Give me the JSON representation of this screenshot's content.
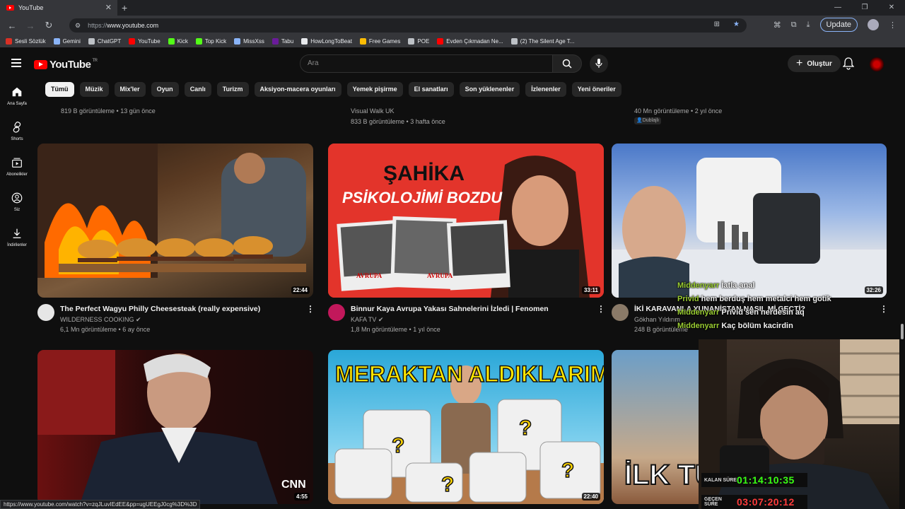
{
  "browser": {
    "tab_title": "YouTube",
    "url_scheme": "https://",
    "url_host": "www.youtube.com",
    "update_label": "Update"
  },
  "bookmarks": [
    {
      "label": "Sesli Sözlük",
      "color": "#d93025"
    },
    {
      "label": "Gemini",
      "color": "#8ab4f8"
    },
    {
      "label": "ChatGPT",
      "color": "#bdc1c6"
    },
    {
      "label": "YouTube",
      "color": "#ff0000"
    },
    {
      "label": "Kick",
      "color": "#53fc18"
    },
    {
      "label": "Top Kick",
      "color": "#53fc18"
    },
    {
      "label": "MissXss",
      "color": "#8ab4f8"
    },
    {
      "label": "Tabu",
      "color": "#6a1b9a"
    },
    {
      "label": "HowLongToBeat",
      "color": "#e8eaed"
    },
    {
      "label": "Free Games",
      "color": "#fbbc04"
    },
    {
      "label": "POE",
      "color": "#bdc1c6"
    },
    {
      "label": "Evden Çıkmadan Ne...",
      "color": "#ff0000"
    },
    {
      "label": "(2) The Silent Age T...",
      "color": "#bdc1c6"
    }
  ],
  "youtube": {
    "logo_text": "YouTube",
    "region": "TR",
    "search_placeholder": "Ara",
    "create_label": "Oluştur"
  },
  "sidebar": [
    {
      "label": "Ana Sayfa",
      "icon": "home-icon"
    },
    {
      "label": "Shorts",
      "icon": "shorts-icon"
    },
    {
      "label": "Abonelikler",
      "icon": "subscriptions-icon"
    },
    {
      "label": "Siz",
      "icon": "you-icon"
    },
    {
      "label": "İndirilenler",
      "icon": "downloads-icon"
    }
  ],
  "chips": [
    "Tümü",
    "Müzik",
    "Mix'ler",
    "Oyun",
    "Canlı",
    "Turizm",
    "Aksiyon-macera oyunları",
    "Yemek pişirme",
    "El sanatları",
    "Son yüklenenler",
    "İzlenenler",
    "Yeni öneriler"
  ],
  "top_row": [
    {
      "meta": "819 B görüntüleme • 13 gün önce"
    },
    {
      "channel": "Visual Walk UK",
      "meta": "833 B görüntüleme • 3 hafta önce"
    },
    {
      "meta": "40 Mn görüntüleme • 2 yıl önce",
      "badge": "Dublajlı"
    }
  ],
  "videos": [
    {
      "title": "The Perfect Wagyu Philly Cheesesteak (really expensive)",
      "channel": "WILDERNESS COOKING",
      "meta": "6,1 Mn görüntüleme • 6 ay önce",
      "duration": "22:44"
    },
    {
      "title": "Binnur Kaya Avrupa Yakası Sahnelerini İzledi | Fenomen",
      "channel": "KAFA TV",
      "meta": "1,8 Mn görüntüleme • 1 yıl önce",
      "duration": "33:11",
      "thumb_title1": "ŞAHİKA",
      "thumb_title2": "PSİKOLOJİMİ BOZDU",
      "thumb_tag": "AVRUPA"
    },
    {
      "title": "İKİ KARAVANLA YUNANİSTAN NASIL Mİ GEÇTİ?",
      "channel": "Gökhan Yıldırım",
      "meta": "248 B görüntüleme",
      "duration": "32:26"
    }
  ],
  "videos_row3": [
    {
      "duration": "4:55",
      "thumb_tag": "CNN TÜRK"
    },
    {
      "duration": "22:40",
      "thumb_title": "MERAKTAN ALDIKLARIM"
    },
    {
      "thumb_title": "İLK TÜ"
    }
  ],
  "chat": [
    {
      "user": "Middenyarr",
      "msg": "İatla anal"
    },
    {
      "user": "Privid",
      "msg": "hem berduş hem metalci hem gotik"
    },
    {
      "user": "Middenyarr",
      "msg": "Privid sen nerdesin aq"
    },
    {
      "user": "Middenyarr",
      "msg": "Kaç bölüm kacirdin"
    }
  ],
  "timers": [
    {
      "label": "KALAN SÜRE",
      "value": "01:14:10:35",
      "color": "#39ff14"
    },
    {
      "label": "GEÇEN SÜRE",
      "value": "03:07:20:12",
      "color": "#ff3b3b"
    }
  ],
  "status_url": "https://www.youtube.com/watch?v=zqJLuvIEdEE&pp=ugUEEgJ0cg%3D%3D"
}
